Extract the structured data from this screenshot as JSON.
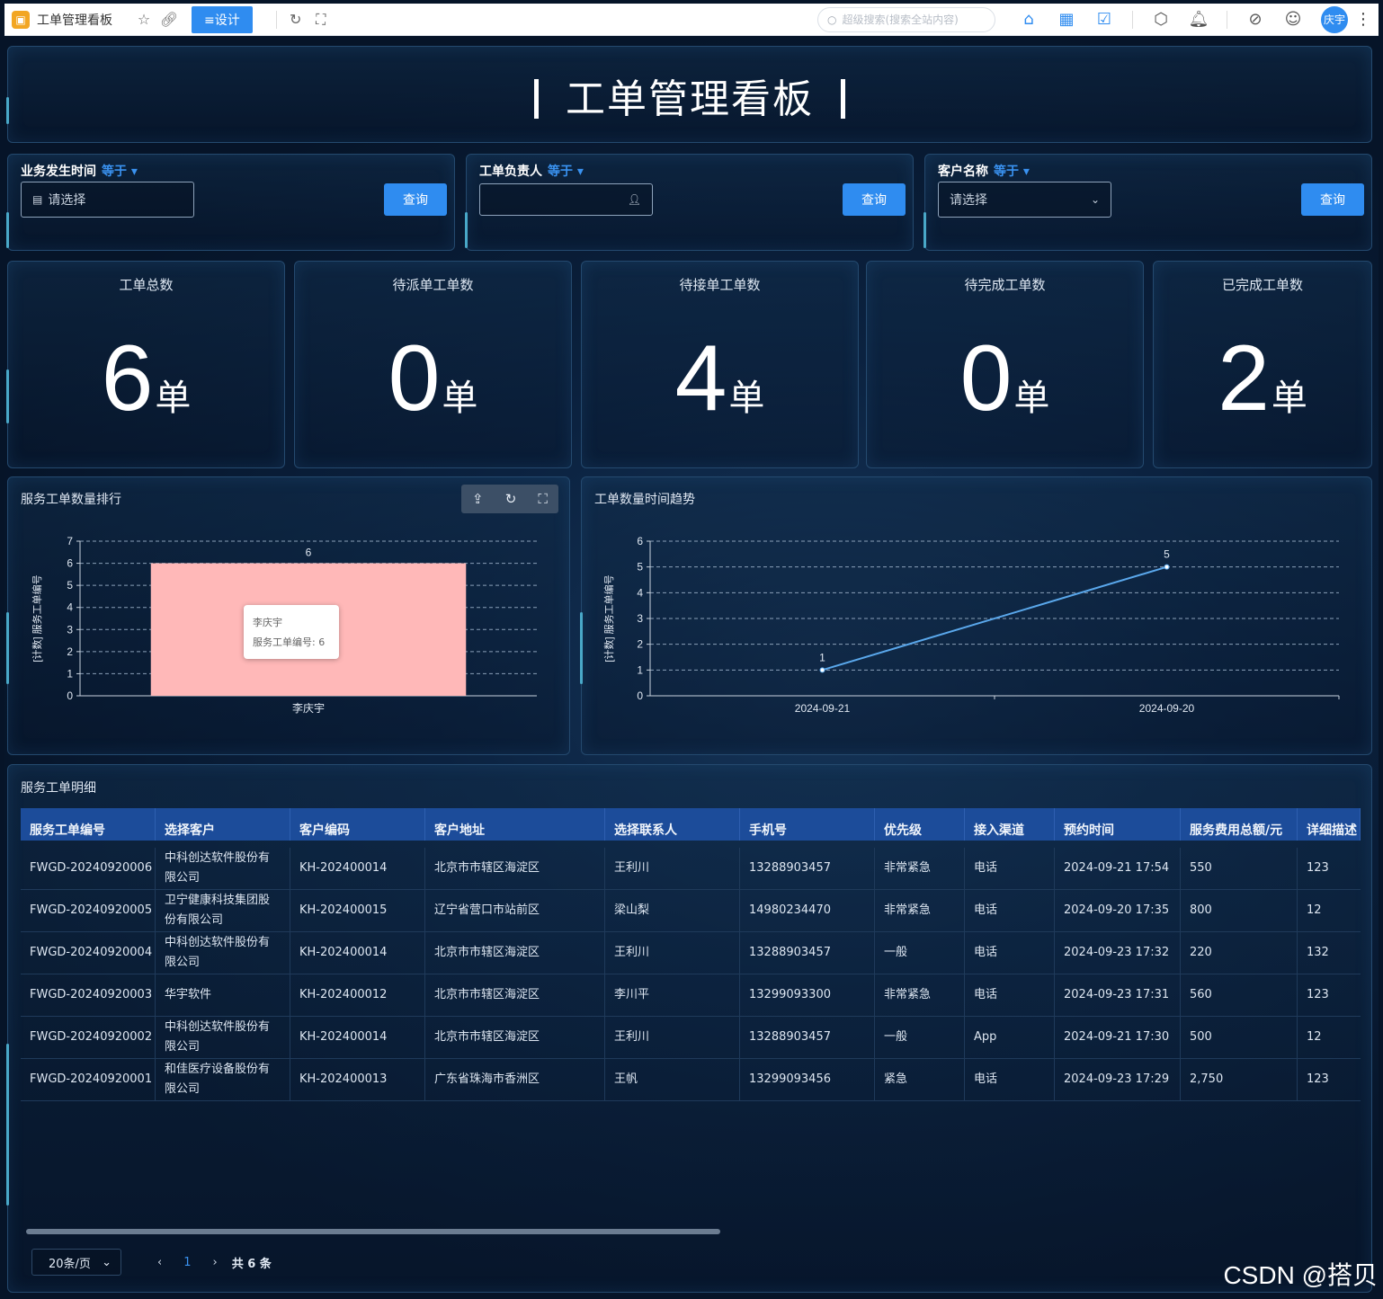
{
  "app": {
    "tab_title": "工单管理看板",
    "design_label": "≡设计",
    "search_placeholder": "超级搜索(搜索全站内容)",
    "user": "庆宇"
  },
  "page": {
    "title": "工单管理看板"
  },
  "filters": [
    {
      "label": "业务发生时间",
      "operator": "等于",
      "placeholder": "请选择",
      "icon": "calendar-icon",
      "button": "查询"
    },
    {
      "label": "工单负责人",
      "operator": "等于",
      "placeholder": "",
      "icon": "user-icon",
      "button": "查询"
    },
    {
      "label": "客户名称",
      "operator": "等于",
      "placeholder": "请选择",
      "icon": "chevron-down-icon",
      "button": "查询"
    }
  ],
  "stats": [
    {
      "label": "工单总数",
      "value": "6",
      "unit": "单"
    },
    {
      "label": "待派单工单数",
      "value": "0",
      "unit": "单"
    },
    {
      "label": "待接单工单数",
      "value": "4",
      "unit": "单"
    },
    {
      "label": "待完成工单数",
      "value": "0",
      "unit": "单"
    },
    {
      "label": "已完成工单数",
      "value": "2",
      "unit": "单"
    }
  ],
  "chart_data": [
    {
      "type": "bar",
      "title": "服务工单数量排行",
      "categories": [
        "李庆宇"
      ],
      "series": [
        {
          "name": "服务工单编号",
          "values": [
            6
          ]
        }
      ],
      "ylabel": "[计数] 服务工单编号",
      "ylim": [
        0,
        7
      ],
      "yticks": [
        0,
        1,
        2,
        3,
        4,
        5,
        6,
        7
      ],
      "grid": true,
      "bar_color": "#ffb8b8",
      "tooltip": {
        "title": "李庆宇",
        "text": "服务工单编号: 6"
      }
    },
    {
      "type": "line",
      "title": "工单数量时间趋势",
      "x": [
        "2024-09-21",
        "2024-09-20"
      ],
      "series": [
        {
          "values": [
            1,
            5
          ]
        }
      ],
      "ylabel": "[计数] 服务工单编号",
      "ylim": [
        0,
        6
      ],
      "yticks": [
        0,
        1,
        2,
        3,
        4,
        5,
        6
      ],
      "grid": true,
      "line_color": "#5aa8ec"
    }
  ],
  "chart_tools": [
    "export-icon",
    "refresh-icon",
    "fullscreen-icon"
  ],
  "table": {
    "title": "服务工单明细",
    "columns": [
      "服务工单编号",
      "选择客户",
      "客户编码",
      "客户地址",
      "选择联系人",
      "手机号",
      "优先级",
      "接入渠道",
      "预约时间",
      "服务费用总额/元",
      "详细描述"
    ],
    "rows": [
      [
        "FWGD-20240920006",
        "中科创达软件股份有限公司",
        "KH-202400014",
        "北京市市辖区海淀区",
        "王利川",
        "13288903457",
        "非常紧急",
        "电话",
        "2024-09-21 17:54",
        "550",
        "123"
      ],
      [
        "FWGD-20240920005",
        "卫宁健康科技集团股份有限公司",
        "KH-202400015",
        "辽宁省营口市站前区",
        "梁山梨",
        "14980234470",
        "非常紧急",
        "电话",
        "2024-09-20 17:35",
        "800",
        "12"
      ],
      [
        "FWGD-20240920004",
        "中科创达软件股份有限公司",
        "KH-202400014",
        "北京市市辖区海淀区",
        "王利川",
        "13288903457",
        "一般",
        "电话",
        "2024-09-23 17:32",
        "220",
        "132"
      ],
      [
        "FWGD-20240920003",
        "华宇软件",
        "KH-202400012",
        "北京市市辖区海淀区",
        "李川平",
        "13299093300",
        "非常紧急",
        "电话",
        "2024-09-23 17:31",
        "560",
        "123"
      ],
      [
        "FWGD-20240920002",
        "中科创达软件股份有限公司",
        "KH-202400014",
        "北京市市辖区海淀区",
        "王利川",
        "13288903457",
        "一般",
        "App",
        "2024-09-21 17:30",
        "500",
        "12"
      ],
      [
        "FWGD-20240920001",
        "和佳医疗设备股份有限公司",
        "KH-202400013",
        "广东省珠海市香洲区",
        "王帆",
        "13299093456",
        "紧急",
        "电话",
        "2024-09-23 17:29",
        "2,750",
        "123"
      ]
    ]
  },
  "pagination": {
    "page_size": "20条/页",
    "current_page": "1",
    "total": "共 6 条"
  },
  "watermark": "CSDN @搭贝"
}
